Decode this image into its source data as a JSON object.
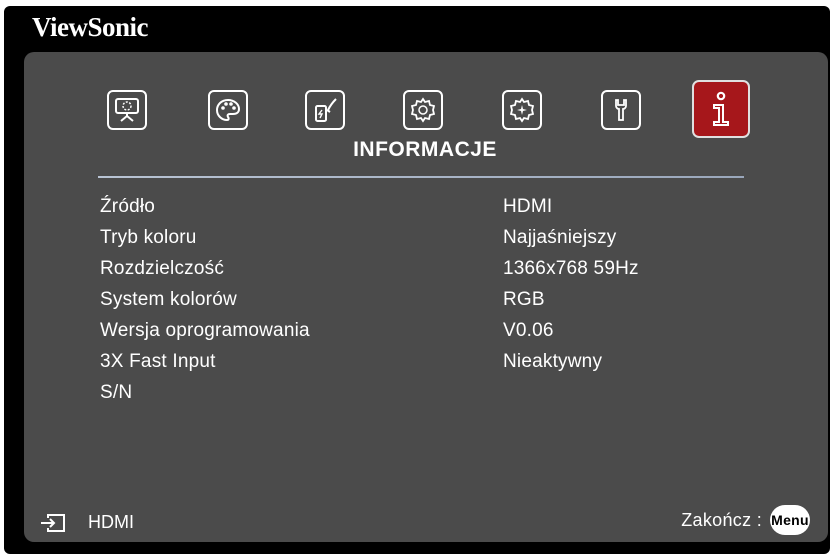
{
  "brand": "ViewSonic",
  "menu": {
    "title": "INFORMACJE",
    "tabs": [
      {
        "icon": "display-icon",
        "selected": false
      },
      {
        "icon": "palette-icon",
        "selected": false
      },
      {
        "icon": "power-brush-icon",
        "selected": false
      },
      {
        "icon": "gear-icon",
        "selected": false
      },
      {
        "icon": "advanced-gear-icon",
        "selected": false
      },
      {
        "icon": "wrench-icon",
        "selected": false
      },
      {
        "icon": "info-icon",
        "selected": true
      }
    ]
  },
  "info": [
    {
      "label": "Źródło",
      "value": "HDMI"
    },
    {
      "label": "Tryb koloru",
      "value": "Najjaśniejszy"
    },
    {
      "label": "Rozdzielczość",
      "value": "1366x768 59Hz"
    },
    {
      "label": "System kolorów",
      "value": "RGB"
    },
    {
      "label": "Wersja oprogramowania",
      "value": "V0.06"
    },
    {
      "label": "3X Fast Input",
      "value": "Nieaktywny"
    },
    {
      "label": "S/N",
      "value": ""
    }
  ],
  "footer": {
    "source_icon": "input-source-icon",
    "source": "HDMI",
    "exit_label": "Zakończ :",
    "exit_button": "Menu"
  },
  "colors": {
    "background": "#000000",
    "panel": "#4b4b4b",
    "selected_tab": "#a6171b",
    "text": "#ffffff"
  }
}
